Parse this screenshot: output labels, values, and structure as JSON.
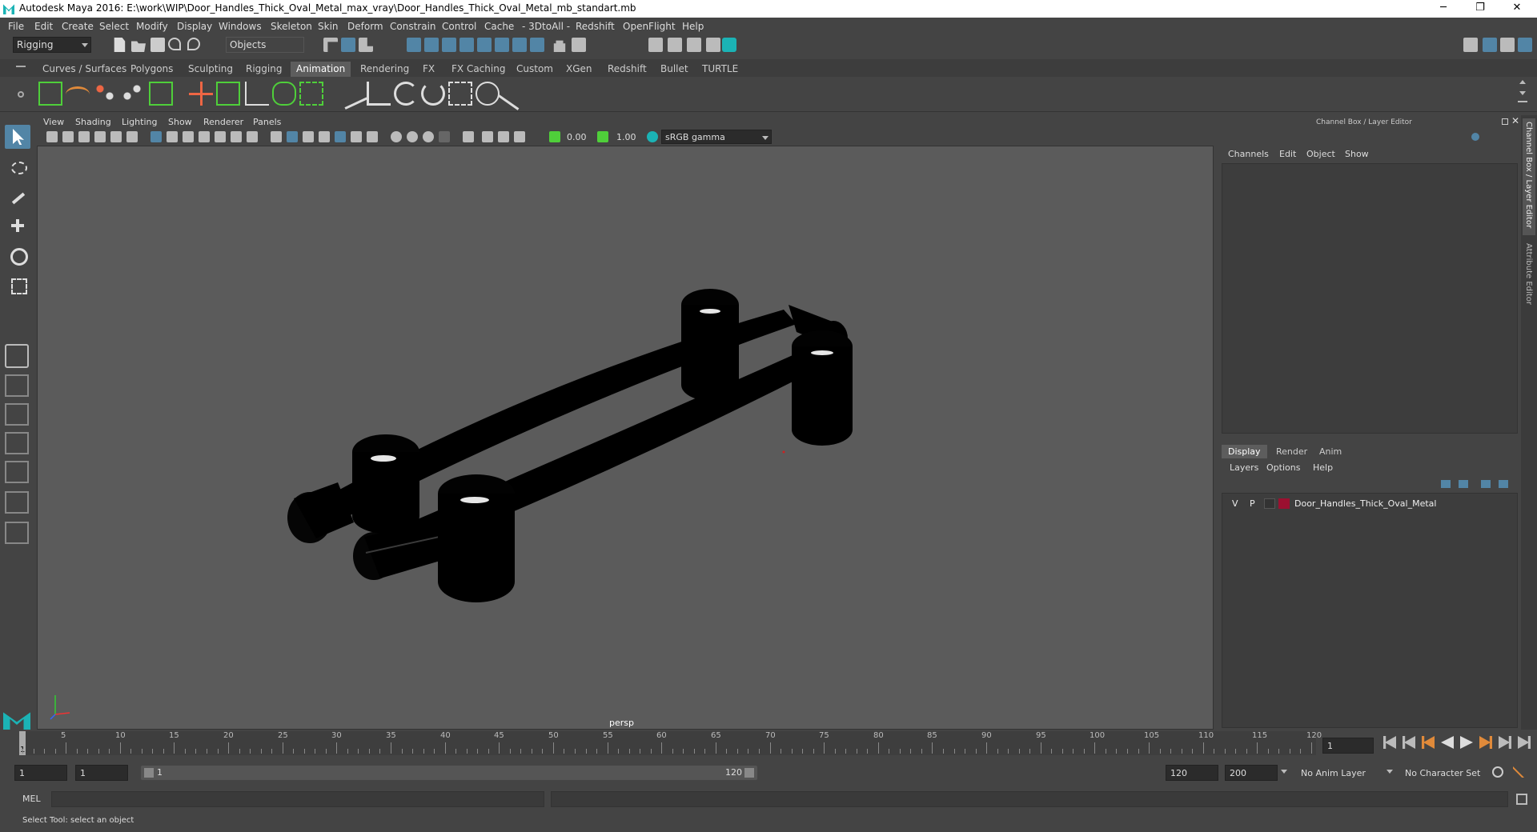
{
  "window": {
    "title": "Autodesk Maya 2016: E:\\work\\WIP\\Door_Handles_Thick_Oval_Metal_max_vray\\Door_Handles_Thick_Oval_Metal_mb_standart.mb",
    "minimize": "─",
    "maximize": "❐",
    "close": "✕"
  },
  "menubar": [
    "File",
    "Edit",
    "Create",
    "Select",
    "Modify",
    "Display",
    "Windows",
    "Skeleton",
    "Skin",
    "Deform",
    "Constrain",
    "Control",
    "Cache",
    "- 3DtoAll -",
    "Redshift",
    "OpenFlight",
    "Help"
  ],
  "statusline": {
    "menuset": "Rigging",
    "selection_mode": "Objects"
  },
  "shelf_tabs": {
    "items": [
      "Curves / Surfaces",
      "Polygons",
      "Sculpting",
      "Rigging",
      "Animation",
      "Rendering",
      "FX",
      "FX Caching",
      "Custom",
      "XGen",
      "Redshift",
      "Bullet",
      "TURTLE"
    ],
    "active": "Animation"
  },
  "viewport": {
    "menu": [
      "View",
      "Shading",
      "Lighting",
      "Show",
      "Renderer",
      "Panels"
    ],
    "exposure": "0.00",
    "gamma": "1.00",
    "colorspace": "sRGB gamma",
    "camera_label": "persp"
  },
  "channel_box": {
    "title": "Channel Box / Layer Editor",
    "menu": [
      "Channels",
      "Edit",
      "Object",
      "Show"
    ],
    "layer_tabs": [
      "Display",
      "Render",
      "Anim"
    ],
    "active_layer_tab": "Display",
    "layer_menu": [
      "Layers",
      "Options",
      "Help"
    ],
    "layer": {
      "visible": "V",
      "playback": "P",
      "name": "Door_Handles_Thick_Oval_Metal",
      "color": "#9b1030"
    },
    "side_tabs": [
      "Channel Box / Layer Editor",
      "Attribute Editor"
    ]
  },
  "timeline": {
    "ticks": [
      5,
      10,
      15,
      20,
      25,
      30,
      35,
      40,
      45,
      50,
      55,
      60,
      65,
      70,
      75,
      80,
      85,
      90,
      95,
      100,
      105,
      110,
      115,
      120
    ],
    "start_marker": "1",
    "current_frame": "1"
  },
  "range": {
    "start": "1",
    "playback_start": "1",
    "slider_start": "1",
    "slider_end": "120",
    "playback_end": "120",
    "end": "200",
    "anim_layer": "No Anim Layer",
    "character_set": "No Character Set"
  },
  "command_line": {
    "language": "MEL"
  },
  "help_line": {
    "text": "Select Tool: select an object"
  },
  "colors": {
    "accent": "#5285a6",
    "shelf_green": "#4fcf3a",
    "maya_teal": "#1bb3b5"
  }
}
